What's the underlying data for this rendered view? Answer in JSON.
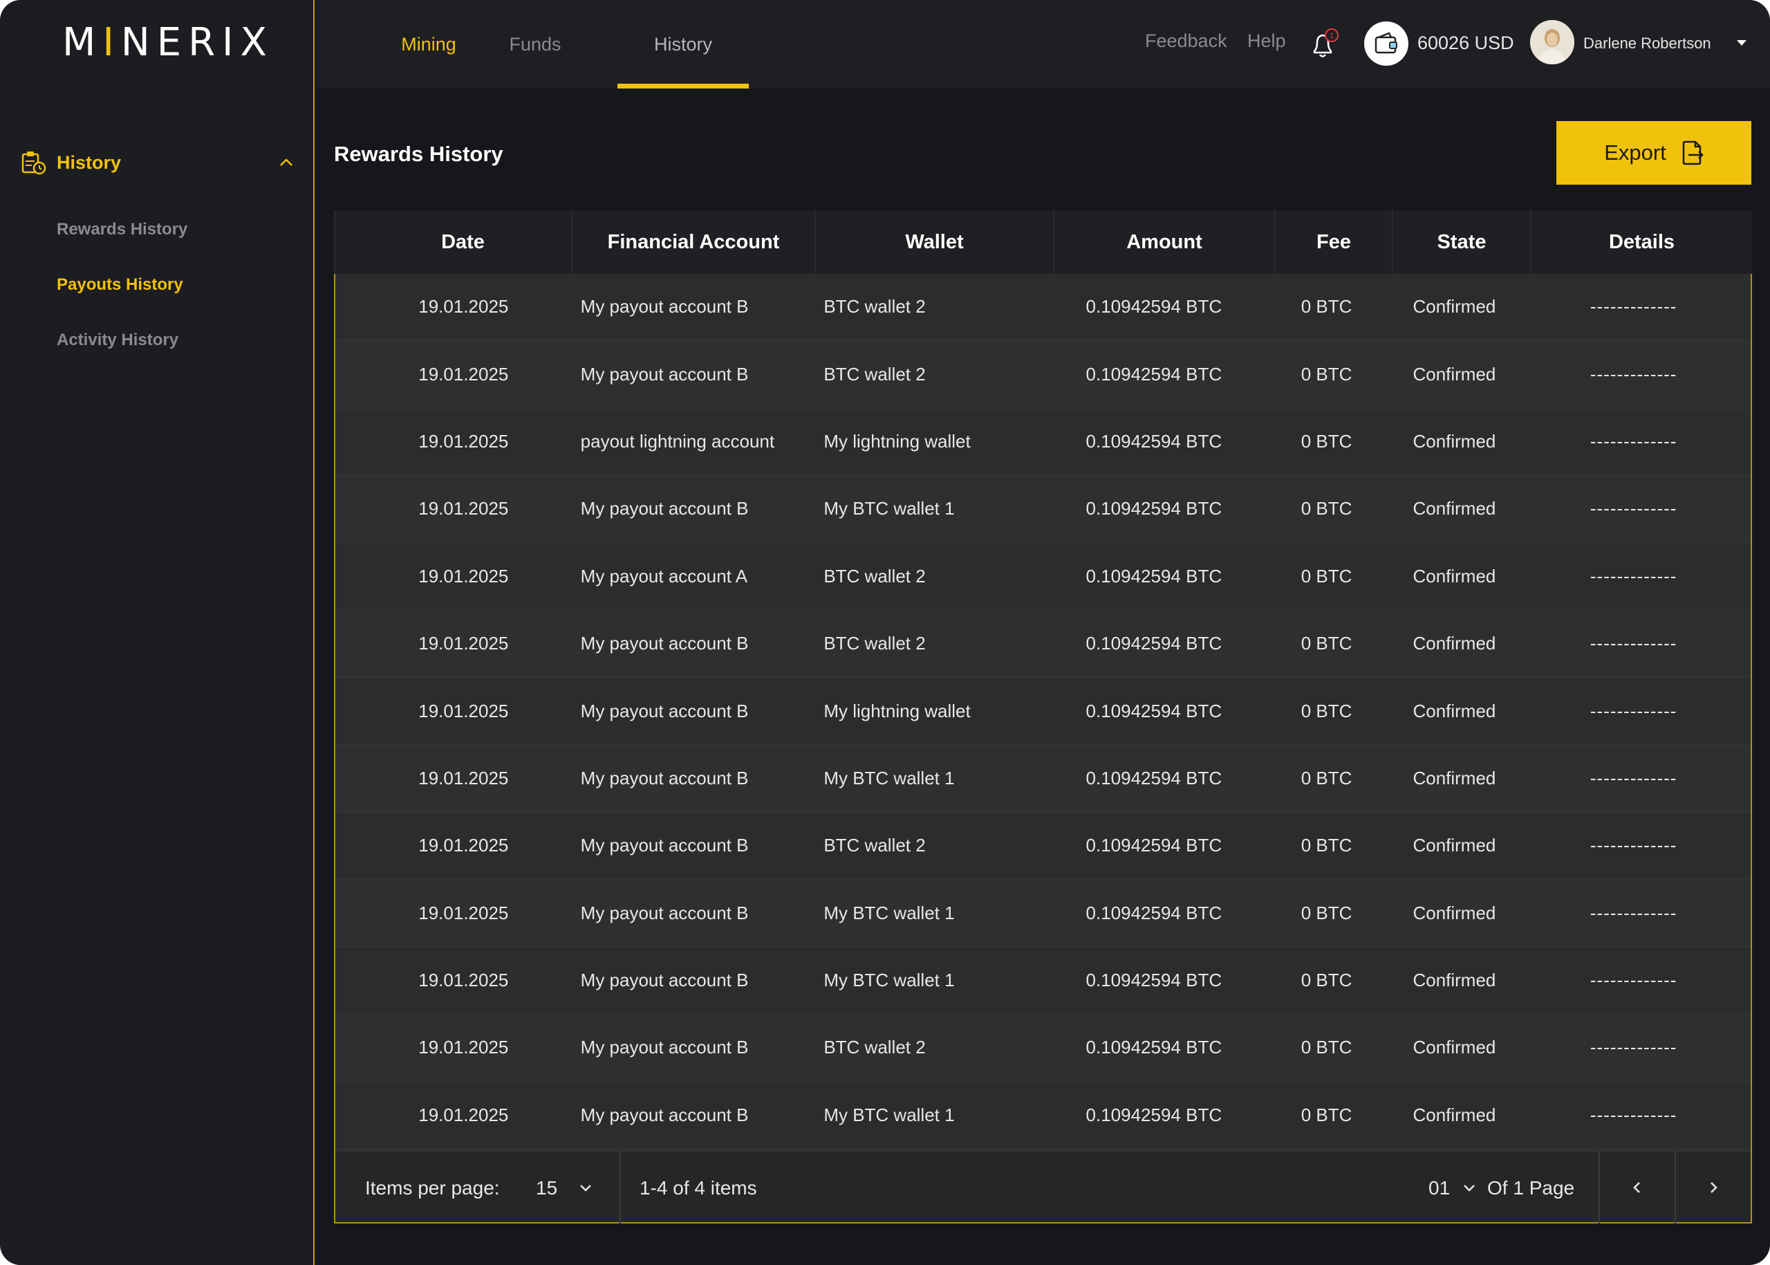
{
  "app": {
    "logo_prefix": "M",
    "logo_accent": "I",
    "logo_rest": "NERIX"
  },
  "sidebar": {
    "section_label": "History",
    "items": [
      {
        "label": "Rewards History",
        "active": false
      },
      {
        "label": "Payouts History",
        "active": true
      },
      {
        "label": "Activity History",
        "active": false
      }
    ]
  },
  "topbar": {
    "tabs": [
      {
        "label": "Mining"
      },
      {
        "label": "Funds"
      },
      {
        "label": "History"
      }
    ],
    "feedback_label": "Feedback",
    "help_label": "Help",
    "notification_count": "1",
    "balance": "60026 USD",
    "user_name": "Darlene Robertson"
  },
  "main": {
    "title": "Rewards History",
    "export_label": "Export"
  },
  "table": {
    "columns": [
      "Date",
      "Financial Account",
      "Wallet",
      "Amount",
      "Fee",
      "State",
      "Details"
    ],
    "rows": [
      [
        "19.01.2025",
        "My payout account B",
        "BTC wallet 2",
        "0.10942594 BTC",
        "0 BTC",
        "Confirmed",
        "-------------"
      ],
      [
        "19.01.2025",
        "My payout account B",
        "BTC wallet 2",
        "0.10942594 BTC",
        "0 BTC",
        "Confirmed",
        "-------------"
      ],
      [
        "19.01.2025",
        "payout lightning account",
        "My lightning wallet",
        "0.10942594 BTC",
        "0 BTC",
        "Confirmed",
        "-------------"
      ],
      [
        "19.01.2025",
        "My payout account B",
        "My BTC wallet 1",
        "0.10942594 BTC",
        "0 BTC",
        "Confirmed",
        "-------------"
      ],
      [
        "19.01.2025",
        "My payout account A",
        "BTC wallet 2",
        "0.10942594 BTC",
        "0 BTC",
        "Confirmed",
        "-------------"
      ],
      [
        "19.01.2025",
        "My payout account B",
        "BTC wallet 2",
        "0.10942594 BTC",
        "0 BTC",
        "Confirmed",
        "-------------"
      ],
      [
        "19.01.2025",
        "My payout account B",
        "My lightning wallet",
        "0.10942594 BTC",
        "0 BTC",
        "Confirmed",
        "-------------"
      ],
      [
        "19.01.2025",
        "My payout account B",
        "My BTC wallet 1",
        "0.10942594 BTC",
        "0 BTC",
        "Confirmed",
        "-------------"
      ],
      [
        "19.01.2025",
        "My payout account B",
        "BTC wallet 2",
        "0.10942594 BTC",
        "0 BTC",
        "Confirmed",
        "-------------"
      ],
      [
        "19.01.2025",
        "My payout account B",
        "My BTC wallet 1",
        "0.10942594 BTC",
        "0 BTC",
        "Confirmed",
        "-------------"
      ],
      [
        "19.01.2025",
        "My payout account B",
        "My BTC wallet 1",
        "0.10942594 BTC",
        "0 BTC",
        "Confirmed",
        "-------------"
      ],
      [
        "19.01.2025",
        "My payout account B",
        "BTC wallet 2",
        "0.10942594 BTC",
        "0 BTC",
        "Confirmed",
        "-------------"
      ],
      [
        "19.01.2025",
        "My payout account B",
        "My BTC wallet 1",
        "0.10942594 BTC",
        "0 BTC",
        "Confirmed",
        "-------------"
      ]
    ]
  },
  "footer": {
    "items_per_page_label": "Items per page:",
    "items_per_page_value": "15",
    "range_text": "1-4 of 4 items",
    "current_page": "01",
    "of_pages": "Of 1 Page"
  },
  "colors": {
    "accent": "#f0c20c",
    "background": "#16171a",
    "sidebar": "#1c1d21"
  },
  "icons": [
    "history-icon",
    "chevron-up-icon",
    "bell-icon",
    "wallet-icon",
    "caret-down-icon",
    "export-icon",
    "chevron-down-icon",
    "chevron-left-icon",
    "chevron-right-icon"
  ]
}
